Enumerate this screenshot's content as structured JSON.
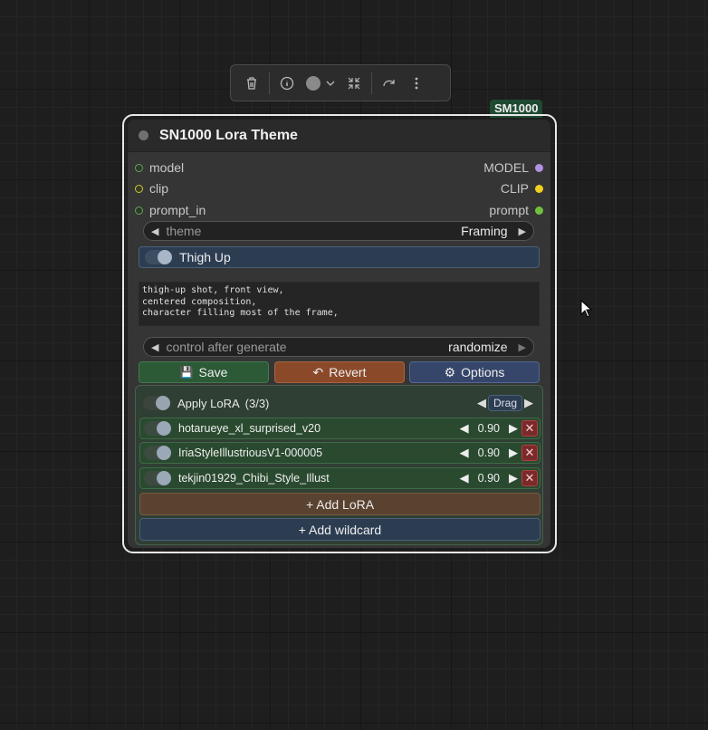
{
  "toolbar": {
    "delete_icon": "trash-icon",
    "info_icon": "info-icon",
    "color_icon": "color-circle-icon",
    "collapse_icon": "shrink-icon",
    "bypass_icon": "redo-arrow-icon",
    "more_icon": "vertical-dots-icon"
  },
  "badge": "SM1000",
  "node": {
    "title": "SN1000 Lora Theme",
    "inputs": [
      {
        "label": "model"
      },
      {
        "label": "clip"
      },
      {
        "label": "prompt_in"
      }
    ],
    "outputs": [
      {
        "label": "MODEL",
        "color": "#b090e0"
      },
      {
        "label": "CLIP",
        "color": "#f0d020"
      },
      {
        "label": "prompt",
        "color": "#70c040"
      }
    ],
    "theme_widget": {
      "label": "theme",
      "value": "Framing"
    },
    "toggle": {
      "label": "Thigh Up",
      "on": true
    },
    "prompt_text": "thigh-up shot, front view,\ncentered composition,\ncharacter filling most of the frame,",
    "control_widget": {
      "label": "control after generate",
      "value": "randomize"
    },
    "buttons": {
      "save": "Save",
      "save_icon": "💾",
      "revert": "Revert",
      "revert_icon": "↶",
      "options": "Options",
      "options_icon": "⚙"
    },
    "lora_panel": {
      "apply_label": "Apply LoRA",
      "apply_count": "(3/3)",
      "drag_label": "Drag",
      "loras": [
        {
          "name": "hotarueye_xl_surprised_v20",
          "strength": "0.90"
        },
        {
          "name": "IriaStyleIllustriousV1-000005",
          "strength": "0.90"
        },
        {
          "name": "tekjin01929_Chibi_Style_Illust",
          "strength": "0.90"
        }
      ],
      "add_lora": "+ Add LoRA",
      "add_wildcard": "+ Add wildcard"
    }
  }
}
